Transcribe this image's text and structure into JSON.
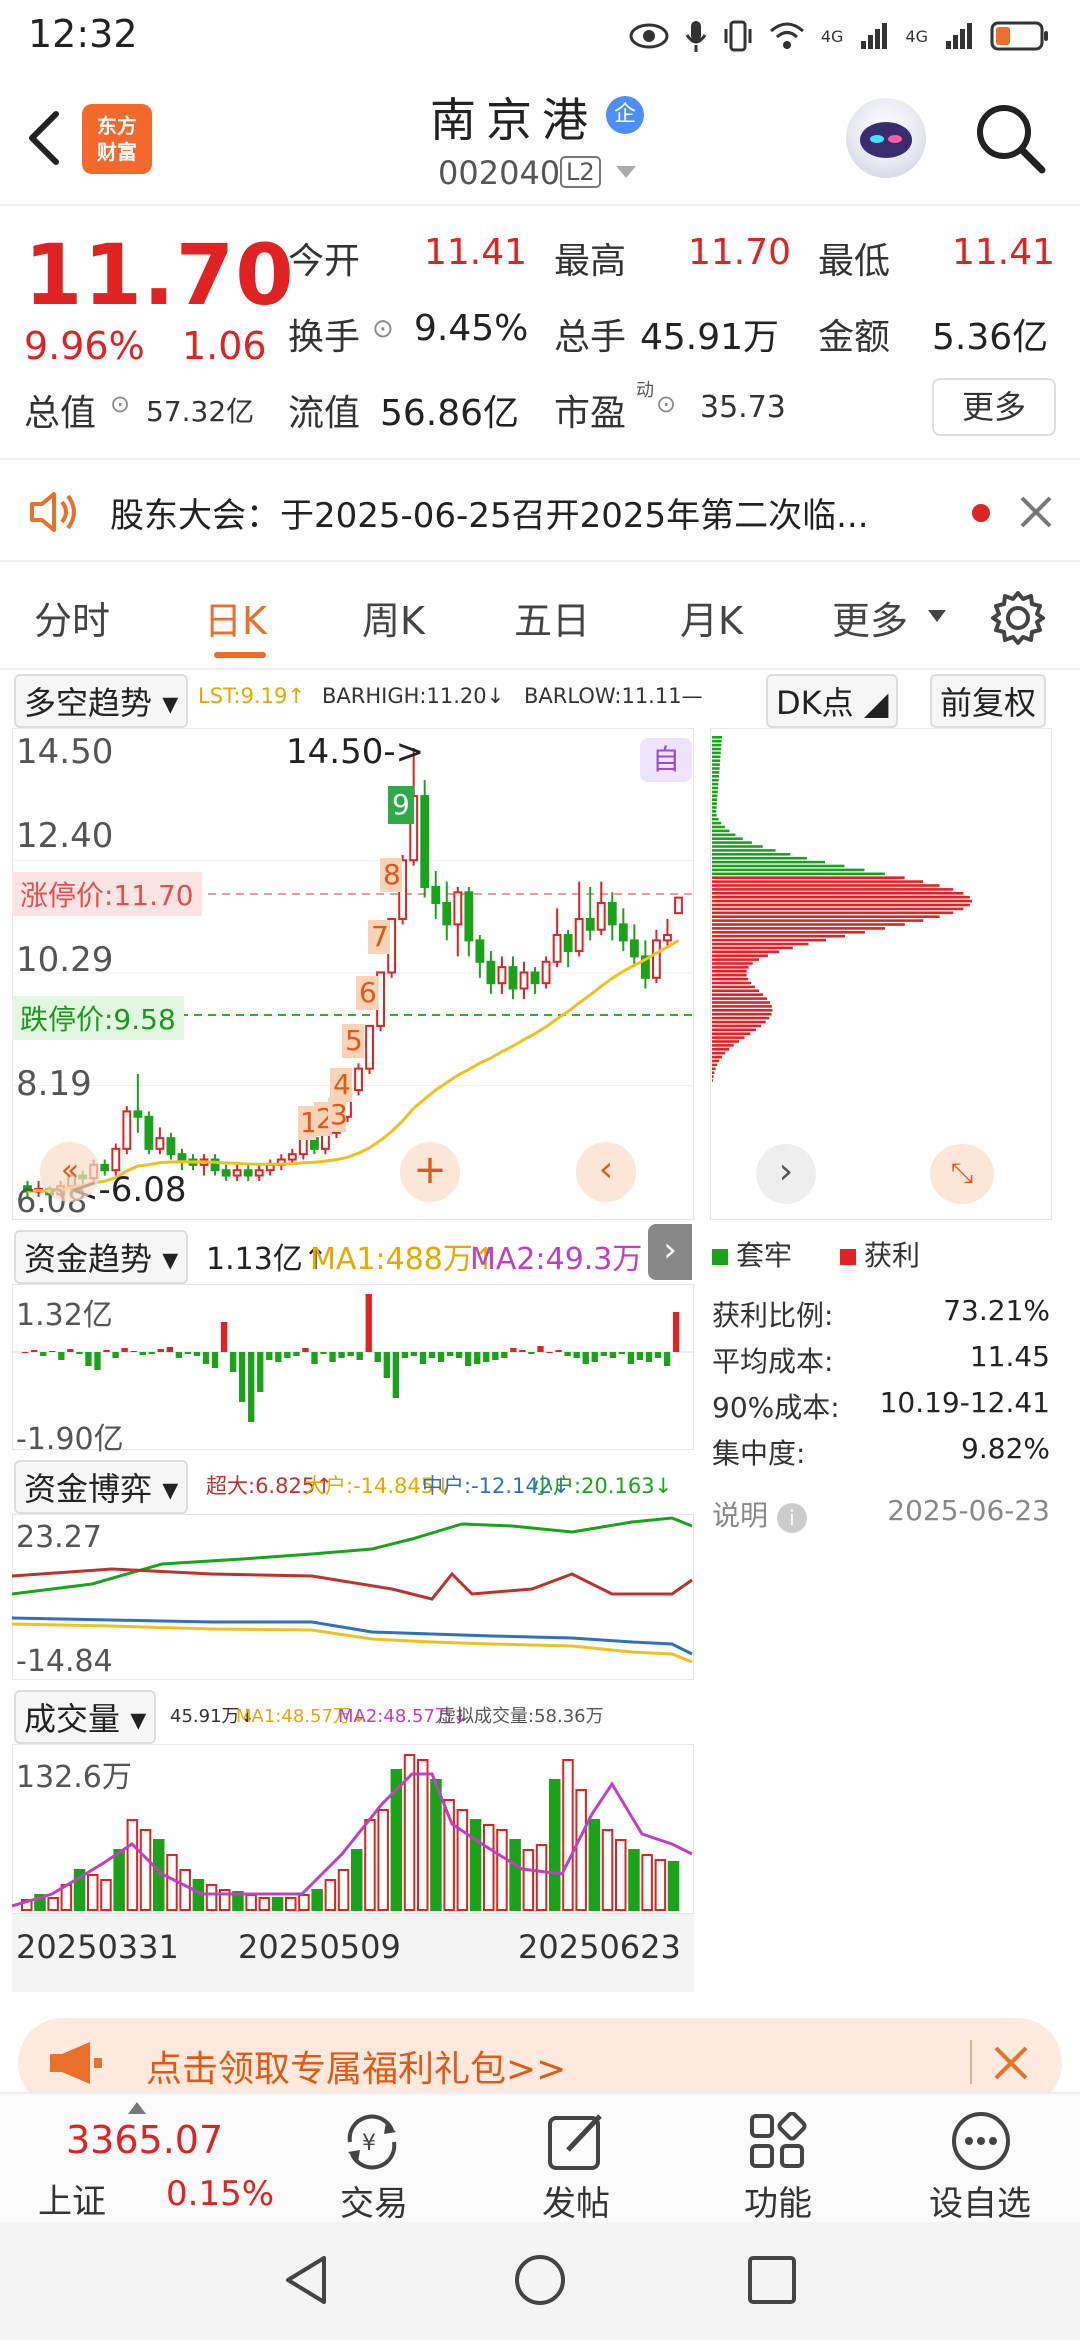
{
  "status_bar": {
    "time": "12:32",
    "net1": "4G",
    "net2": "4G"
  },
  "header": {
    "logo_line1": "东方",
    "logo_line2": "财富",
    "stock_name": "南京港",
    "badge": "企",
    "stock_code": "002040",
    "level_badge": "L2"
  },
  "quote": {
    "price": "11.70",
    "change_pct": "9.96%",
    "change": "1.06",
    "open_label": "今开",
    "open": "11.41",
    "high_label": "最高",
    "high": "11.70",
    "low_label": "最低",
    "low": "11.41",
    "turnover_label": "换手",
    "turnover": "9.45%",
    "volume_label": "总手",
    "volume": "45.91万",
    "amount_label": "金额",
    "amount": "5.36亿",
    "mktcap_label": "总值",
    "mktcap": "57.32亿",
    "float_label": "流值",
    "float": "56.86亿",
    "pe_label": "市盈",
    "pe_sup": "动",
    "pe": "35.73",
    "more_label": "更多"
  },
  "notice": {
    "text": "股东大会：于2025-06-25召开2025年第二次临..."
  },
  "tabs": [
    "分时",
    "日K",
    "周K",
    "五日",
    "月K",
    "更多"
  ],
  "active_tab": "日K",
  "kline": {
    "indicator": "多空趋势",
    "lst": "LST:9.19↑",
    "barhigh": "BARHIGH:11.20↓",
    "barlow": "BARLOW:11.11—",
    "dk_label": "DK点",
    "adjust_label": "前复权",
    "ytick_top": "14.50",
    "ytick_2": "12.40",
    "ytick_3": "10.29",
    "ytick_4": "8.19",
    "ytick_bottom": "6.08",
    "high_marker": "14.50->",
    "low_marker": "<-6.08",
    "limit_up": "涨停价:11.70",
    "limit_down": "跌停价:9.58",
    "auto_badge": "自",
    "seq_labels": [
      "1",
      "2",
      "3",
      "4",
      "5",
      "6",
      "7",
      "8",
      "9"
    ]
  },
  "chart_data": {
    "type": "candlestick",
    "start_date": "20250331",
    "mid_date": "20250509",
    "end_date": "20250623",
    "ylim": [
      6.08,
      14.5
    ],
    "candles": [
      [
        6.3,
        6.2,
        6.4,
        6.1
      ],
      [
        6.2,
        6.25,
        6.4,
        6.1
      ],
      [
        6.25,
        6.15,
        6.3,
        6.08
      ],
      [
        6.15,
        6.3,
        6.4,
        6.1
      ],
      [
        6.3,
        6.5,
        6.6,
        6.2
      ],
      [
        6.5,
        6.45,
        6.6,
        6.3
      ],
      [
        6.45,
        6.7,
        6.8,
        6.4
      ],
      [
        6.7,
        6.6,
        6.8,
        6.5
      ],
      [
        6.6,
        7.0,
        7.1,
        6.5
      ],
      [
        7.0,
        7.7,
        7.8,
        6.9
      ],
      [
        7.7,
        7.6,
        8.4,
        7.3
      ],
      [
        7.6,
        7.0,
        7.7,
        6.9
      ],
      [
        7.0,
        7.2,
        7.4,
        6.9
      ],
      [
        7.2,
        6.9,
        7.3,
        6.8
      ],
      [
        6.9,
        6.8,
        7.0,
        6.6
      ],
      [
        6.8,
        6.7,
        6.9,
        6.6
      ],
      [
        6.7,
        6.8,
        6.9,
        6.5
      ],
      [
        6.8,
        6.6,
        6.9,
        6.5
      ],
      [
        6.6,
        6.5,
        6.7,
        6.4
      ],
      [
        6.5,
        6.6,
        6.7,
        6.4
      ],
      [
        6.6,
        6.5,
        6.7,
        6.4
      ],
      [
        6.5,
        6.6,
        6.7,
        6.4
      ],
      [
        6.6,
        6.7,
        6.8,
        6.5
      ],
      [
        6.7,
        6.8,
        6.9,
        6.6
      ],
      [
        6.8,
        6.9,
        7.0,
        6.7
      ],
      [
        6.9,
        7.2,
        7.3,
        6.8
      ],
      [
        7.2,
        7.0,
        7.3,
        6.9
      ],
      [
        7.0,
        7.3,
        7.4,
        6.9
      ],
      [
        7.3,
        7.6,
        7.7,
        7.2
      ],
      [
        7.6,
        8.1,
        8.2,
        7.5
      ],
      [
        8.1,
        8.5,
        8.6,
        8.0
      ],
      [
        8.5,
        9.3,
        9.3,
        8.4
      ],
      [
        9.3,
        10.3,
        10.3,
        9.2
      ],
      [
        10.3,
        11.3,
        11.3,
        10.2
      ],
      [
        11.3,
        12.4,
        12.5,
        11.2
      ],
      [
        12.4,
        13.6,
        14.5,
        12.3
      ],
      [
        13.6,
        11.9,
        13.9,
        11.7
      ],
      [
        11.9,
        11.6,
        12.2,
        11.3
      ],
      [
        11.6,
        11.2,
        12.0,
        10.9
      ],
      [
        11.2,
        11.8,
        11.9,
        10.6
      ],
      [
        11.8,
        10.9,
        11.9,
        10.6
      ],
      [
        10.9,
        10.5,
        11.0,
        10.2
      ],
      [
        10.5,
        10.1,
        10.7,
        9.9
      ],
      [
        10.1,
        10.4,
        10.6,
        9.9
      ],
      [
        10.4,
        10.0,
        10.6,
        9.8
      ],
      [
        10.0,
        10.3,
        10.5,
        9.8
      ],
      [
        10.3,
        10.1,
        10.4,
        9.9
      ],
      [
        10.1,
        10.5,
        10.6,
        10.0
      ],
      [
        10.5,
        11.0,
        11.5,
        10.4
      ],
      [
        11.0,
        10.7,
        11.1,
        10.4
      ],
      [
        10.7,
        11.3,
        12.0,
        10.6
      ],
      [
        11.3,
        11.1,
        11.9,
        10.9
      ],
      [
        11.1,
        11.6,
        12.0,
        11.0
      ],
      [
        11.6,
        11.2,
        11.8,
        10.9
      ],
      [
        11.2,
        10.9,
        11.5,
        10.7
      ],
      [
        10.9,
        10.6,
        11.2,
        10.4
      ],
      [
        10.6,
        10.2,
        10.9,
        10.0
      ],
      [
        10.2,
        10.9,
        11.1,
        10.1
      ],
      [
        10.9,
        11.0,
        11.3,
        10.8
      ],
      [
        11.41,
        11.7,
        11.7,
        11.41
      ]
    ]
  },
  "chips": {
    "legend_trapped": "套牢",
    "legend_profit": "获利",
    "rows": [
      {
        "label": "获利比例:",
        "value": "73.21%"
      },
      {
        "label": "平均成本:",
        "value": "11.45"
      },
      {
        "label": "90%成本:",
        "value": "10.19-12.41"
      },
      {
        "label": "集中度:",
        "value": "9.82%"
      }
    ],
    "note_label": "说明",
    "date": "2025-06-23"
  },
  "fund_trend": {
    "title": "资金趋势",
    "value": "1.13亿↑",
    "ma1": "MA1:488万↑",
    "ma2": "MA2:49.3万↑",
    "ytop": "1.32亿",
    "ybottom": "-1.90亿"
  },
  "fund_game": {
    "title": "资金博弈",
    "super": "超大:6.825↑",
    "large": "大户:-14.845↓",
    "mid": "中户:-12.142↓",
    "small": "小户:20.163↓",
    "ytop": "23.27",
    "ybottom": "-14.84"
  },
  "volume": {
    "title": "成交量",
    "vol": "45.91万↓",
    "ma1": "MA1:48.57万↓",
    "ma2": "MA2:48.57万↓",
    "virtual": "虚拟成交量:58.36万",
    "ytop": "132.6万",
    "date1": "20250331",
    "date2": "20250509",
    "date3": "20250623"
  },
  "banner": {
    "text": "点击领取专属福利礼包>>"
  },
  "bottom_nav": {
    "index_value": "3365.07",
    "index_name": "上证",
    "index_pct": "0.15%",
    "trade": "交易",
    "post": "发帖",
    "function": "功能",
    "watch": "设自选"
  },
  "colors": {
    "up": "#e02222",
    "down": "#1aa31a",
    "accent": "#f2692b",
    "ma_yellow": "#f0c020",
    "ma_purple": "#c040c0"
  }
}
